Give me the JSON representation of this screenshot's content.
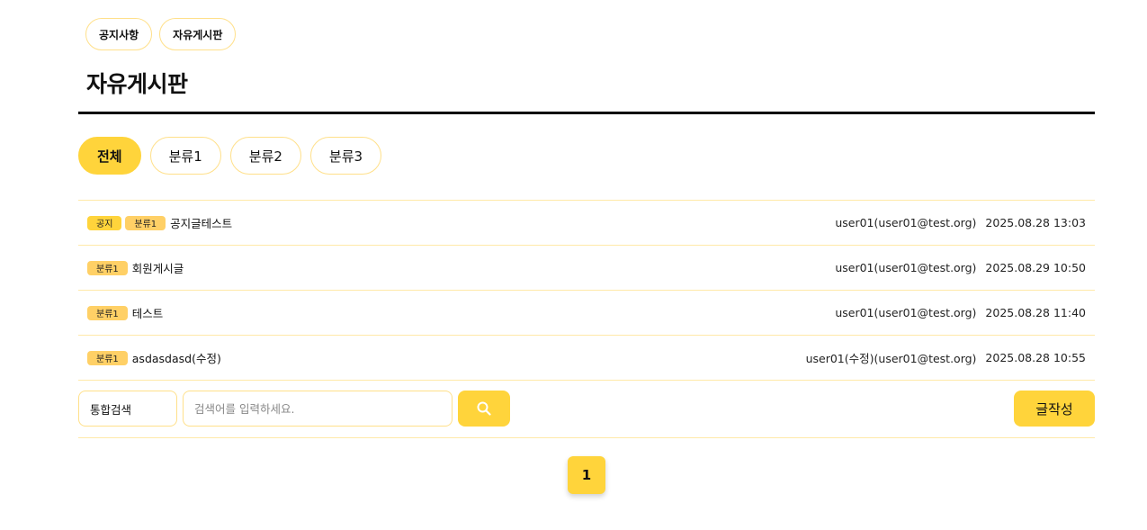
{
  "board_nav": [
    {
      "label": "공지사항"
    },
    {
      "label": "자유게시판"
    }
  ],
  "page_title": "자유게시판",
  "category_tabs": [
    {
      "label": "전체",
      "active": true
    },
    {
      "label": "분류1",
      "active": false
    },
    {
      "label": "분류2",
      "active": false
    },
    {
      "label": "분류3",
      "active": false
    }
  ],
  "posts": [
    {
      "notice": "공지",
      "category": "분류1",
      "title": "공지글테스트",
      "author": "user01(user01@test.org)",
      "date": "2025.08.28 13:03"
    },
    {
      "notice": null,
      "category": "분류1",
      "title": "회원게시글",
      "author": "user01(user01@test.org)",
      "date": "2025.08.29 10:50"
    },
    {
      "notice": null,
      "category": "분류1",
      "title": "테스트",
      "author": "user01(user01@test.org)",
      "date": "2025.08.28 11:40"
    },
    {
      "notice": null,
      "category": "분류1",
      "title": "asdasdasd(수정)",
      "author": "user01(수정)(user01@test.org)",
      "date": "2025.08.28 10:55"
    }
  ],
  "search": {
    "scope": "통합검색",
    "placeholder": "검색어를 입력하세요.",
    "value": "",
    "button_icon": "search-icon"
  },
  "write_button": "글작성",
  "pagination": {
    "current_page": "1"
  },
  "colors": {
    "accent": "#ffd43b",
    "category_badge": "#ffd066",
    "border": "#ffe08a"
  }
}
